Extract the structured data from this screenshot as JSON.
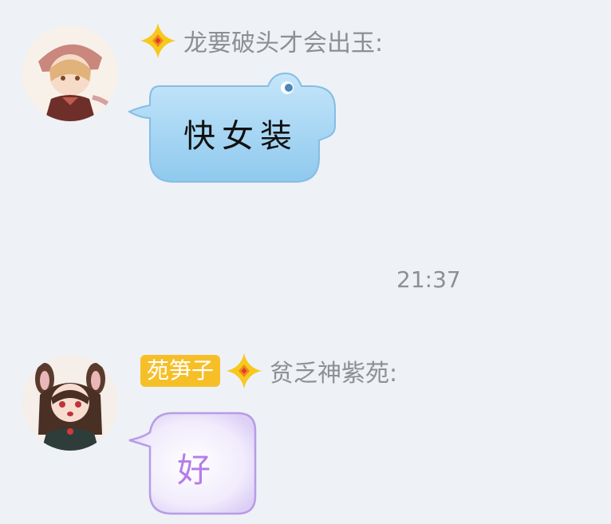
{
  "messages": [
    {
      "sender": "龙要破头才会出玉:",
      "text": "快女装"
    },
    {
      "title": "苑笋子",
      "sender": "贫乏神紫苑:",
      "text": "好"
    }
  ],
  "timestamp": "21:37",
  "colors": {
    "background": "#eef1f6",
    "name_text": "#8e8f94",
    "badge": "#f6bf28",
    "bubble_blue": "#9fd3f2",
    "bubble_purple": "#efe8fb"
  }
}
